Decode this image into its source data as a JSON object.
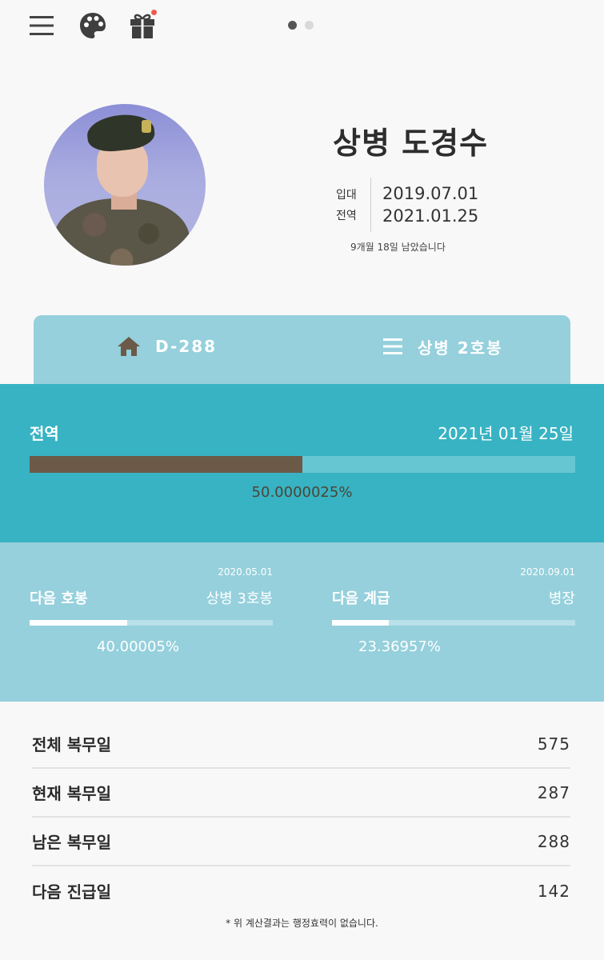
{
  "topbar": {
    "icons": [
      "menu-icon",
      "palette-icon",
      "gift-icon"
    ],
    "notification_dot_color": "#ef5b4e",
    "pager_pages": 2,
    "pager_active": 1
  },
  "profile": {
    "name": "상병 도경수",
    "enlist_label": "입대",
    "discharge_label": "전역",
    "enlist_date": "2019.07.01",
    "discharge_date": "2021.01.25",
    "remaining_text": "9개월 18일 남았습니다"
  },
  "tabs": {
    "dday_label": "D-288",
    "rank_label": "상병 2호봉"
  },
  "discharge": {
    "label": "전역",
    "date_text": "2021년 01월 25일",
    "progress_percent": 50.0000025,
    "progress_text": "50.0000025%"
  },
  "next_pay": {
    "date": "2020.05.01",
    "label": "다음 호봉",
    "value": "상병 3호봉",
    "progress_percent": 40.00005,
    "progress_text": "40.00005%"
  },
  "next_rank": {
    "date": "2020.09.01",
    "label": "다음 계급",
    "value": "병장",
    "progress_percent": 23.36957,
    "progress_text": "23.36957%"
  },
  "stats": [
    {
      "label": "전체 복무일",
      "value": "575"
    },
    {
      "label": "현재 복무일",
      "value": "287"
    },
    {
      "label": "남은 복무일",
      "value": "288"
    },
    {
      "label": "다음 진급일",
      "value": "142"
    }
  ],
  "footnote": "* 위 계산결과는 행정효력이 없습니다.",
  "colors": {
    "accent": "#38b3c3",
    "light_accent": "#95d0dc",
    "progress_fill": "#6b5a48"
  }
}
